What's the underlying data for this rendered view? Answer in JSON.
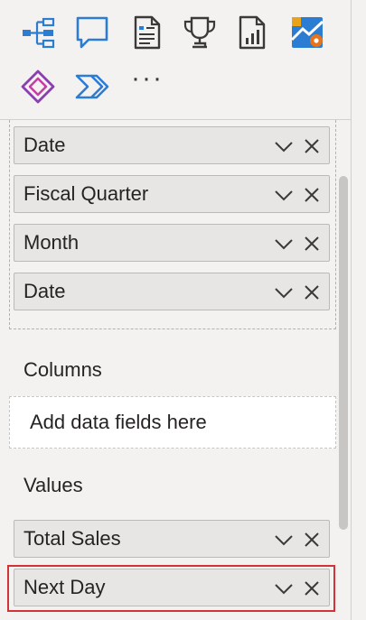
{
  "toolbar": {
    "icons": [
      {
        "name": "decomposition-tree-icon",
        "color": "#2b7cd3"
      },
      {
        "name": "qa-chat-icon",
        "color": "#2b7cd3"
      },
      {
        "name": "smart-narrative-icon",
        "color": "#3b3a39"
      },
      {
        "name": "trophy-icon",
        "color": "#3b3a39"
      },
      {
        "name": "paginated-report-icon",
        "color": "#3b3a39"
      },
      {
        "name": "azure-map-icon",
        "color": "#2b7cd3"
      },
      {
        "name": "power-apps-icon",
        "color": "#8a3fb0"
      },
      {
        "name": "power-automate-icon",
        "color": "#2b7cd3"
      }
    ],
    "more_label": "···"
  },
  "rows": [
    {
      "label": "Date"
    },
    {
      "label": "Fiscal Quarter"
    },
    {
      "label": "Month"
    },
    {
      "label": "Date"
    }
  ],
  "columns": {
    "title": "Columns",
    "placeholder": "Add data fields here"
  },
  "values": {
    "title": "Values",
    "items": [
      {
        "label": "Total Sales"
      },
      {
        "label": "Next Day"
      }
    ]
  },
  "colors": {
    "highlight": "#d13438",
    "chip_bg": "#e8e6e4",
    "panel_bg": "#f3f2f1"
  }
}
